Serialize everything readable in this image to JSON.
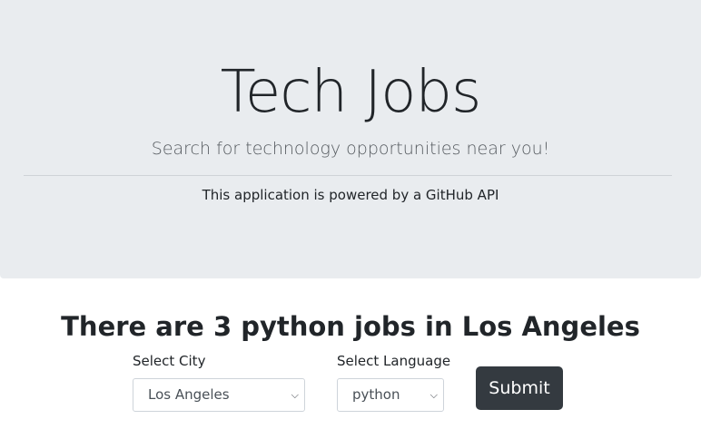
{
  "header": {
    "title": "Tech Jobs",
    "subtitle": "Search for technology opportunities near you!",
    "powered_by": "This application is powered by a GitHub API"
  },
  "results": {
    "heading": "There are 3 python jobs in Los Angeles"
  },
  "form": {
    "city_label": "Select City",
    "city_value": "Los Angeles",
    "language_label": "Select Language",
    "language_value": "python",
    "submit_label": "Submit"
  },
  "colors": {
    "header_bg": "#e9ecef",
    "button_bg": "#343a40"
  }
}
